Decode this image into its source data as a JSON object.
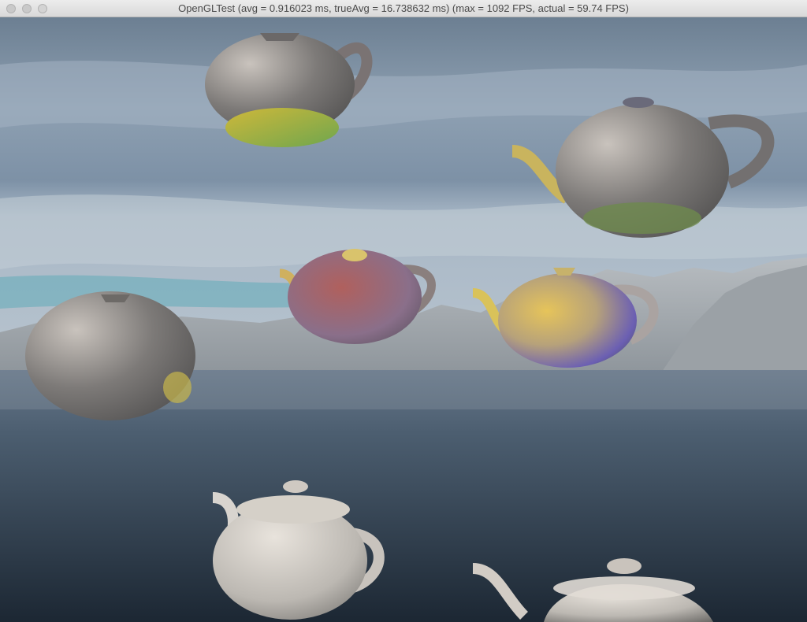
{
  "window": {
    "title": "OpenGLTest (avg = 0.916023 ms, trueAvg = 16.738632 ms) (max = 1092 FPS, actual = 59.74 FPS)"
  },
  "titlebar": {
    "buttons": [
      {
        "name": "close",
        "icon": "close-icon"
      },
      {
        "name": "minimize",
        "icon": "minimize-icon"
      },
      {
        "name": "zoom",
        "icon": "zoom-icon"
      }
    ]
  },
  "scene": {
    "sky_colors": [
      "#5f7286",
      "#8ea0b3",
      "#a9b7c4"
    ],
    "water_colors": [
      "#4e5f6f",
      "#1f2b37"
    ],
    "mountain_color": "#a9aeb2",
    "teapot_count": 7
  }
}
